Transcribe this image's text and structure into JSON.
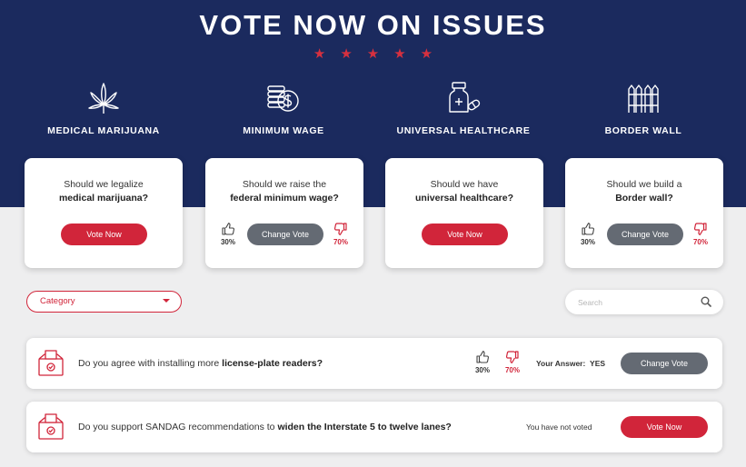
{
  "page": {
    "title": "VOTE NOW ON ISSUES",
    "stars": "★★★★★"
  },
  "colors": {
    "navy": "#1b2a5e",
    "accent_red": "#d1253a",
    "button_gray": "#646a73",
    "background": "#eeeeef"
  },
  "issues": [
    {
      "label": "MEDICAL MARIJUANA",
      "icon": "cannabis-leaf-icon",
      "question_prefix": "Should we legalize",
      "question_bold": "medical marijuana?",
      "state": "not-voted",
      "button_label": "Vote Now"
    },
    {
      "label": "MINIMUM WAGE",
      "icon": "coins-dollar-icon",
      "question_prefix": "Should we raise the",
      "question_bold": "federal minimum wage?",
      "state": "voted",
      "button_label": "Change Vote",
      "up_percent": "30%",
      "down_percent": "70%"
    },
    {
      "label": "UNIVERSAL HEALTHCARE",
      "icon": "medicine-bottle-icon",
      "question_prefix": "Should we have",
      "question_bold": "universal healthcare?",
      "state": "not-voted",
      "button_label": "Vote Now"
    },
    {
      "label": "BORDER WALL",
      "icon": "fence-icon",
      "question_prefix": "Should we build a",
      "question_bold": "Border wall?",
      "state": "voted",
      "button_label": "Change Vote",
      "up_percent": "30%",
      "down_percent": "70%"
    }
  ],
  "filters": {
    "category_label": "Category",
    "search_placeholder": "Search"
  },
  "questions": [
    {
      "icon": "ballot-box-icon",
      "prefix": "Do you agree with installing more ",
      "bold": "license-plate readers?",
      "up_percent": "30%",
      "down_percent": "70%",
      "answer_label": "Your Answer:",
      "answer_value": "YES",
      "button_label": "Change Vote"
    },
    {
      "icon": "ballot-box-icon",
      "prefix": "Do you support SANDAG recommendations to ",
      "bold": "widen the Interstate 5 to twelve lanes?",
      "status": "You have not voted",
      "button_label": "Vote Now"
    }
  ]
}
